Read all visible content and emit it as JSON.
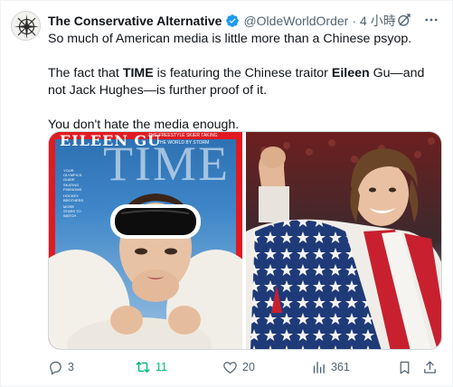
{
  "author": {
    "display_name": "The Conservative Alternative",
    "handle": "@OldeWorldOrder",
    "time": "4 小時",
    "verified_icon": "verified-badge-icon",
    "avatar_icon": "compass-rose-icon"
  },
  "tweet": {
    "line1": "So much of American media is little more than a Chinese psyop.",
    "line2_pre": "The fact that ",
    "line2_time": "TIME",
    "line2_mid": " is featuring the Chinese traitor ",
    "line2_eileen": "Eileen",
    "line2_post": " Gu—and not Jack Hughes—is further proof of it.",
    "line3": "You don't hate the media enough."
  },
  "media": {
    "left_image": {
      "masthead": "TIME",
      "cover_name": "EILEEN GU",
      "cover_tagline_1": "THE FREESTYLE SKIER TAKING",
      "cover_tagline_2": "THE WORLD BY STORM",
      "cover_side_1": "YOUR OLYMPICS GUIDE",
      "cover_side_2": "SKATING PHENOMS",
      "cover_side_3": "HOCKEY BROTHERS",
      "cover_side_4": "MORE STARS TO WATCH"
    },
    "right_image": {
      "description_icon": "hockey-player-with-flag-photo"
    }
  },
  "actions": {
    "reply_count": "3",
    "retweet_count": "11",
    "like_count": "20",
    "views_count": "361"
  },
  "colors": {
    "text_primary": "#0f1419",
    "text_secondary": "#536471",
    "verified_blue": "#1d9bf0",
    "retweet_green": "#00ba7c",
    "time_red": "#e11a22"
  },
  "header_icons": [
    "grok-icon",
    "more-icon"
  ]
}
